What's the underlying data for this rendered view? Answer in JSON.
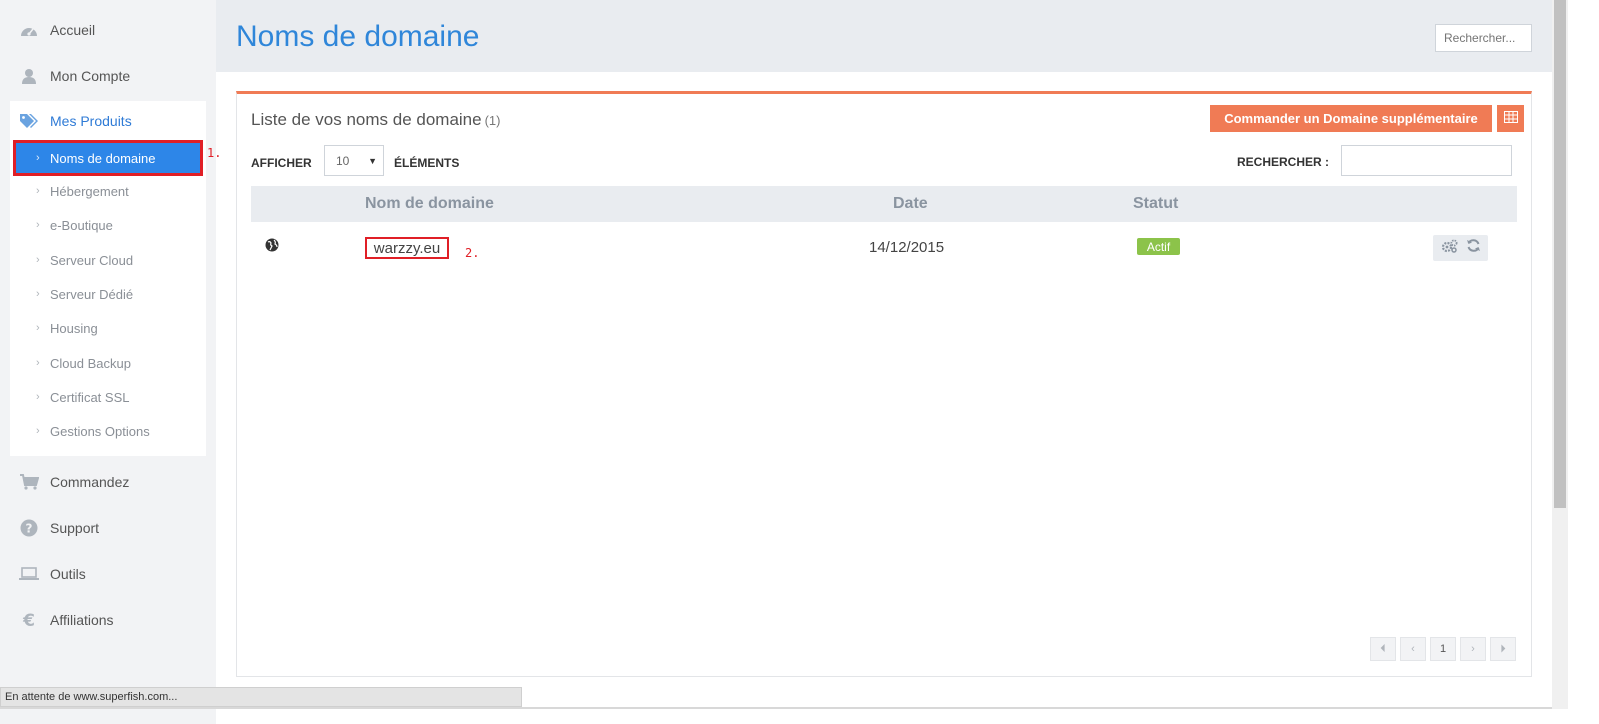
{
  "sidebar": {
    "top_items": [
      {
        "label": "Accueil",
        "icon": "dashboard-icon"
      },
      {
        "label": "Mon Compte",
        "icon": "user-icon"
      }
    ],
    "products": {
      "label": "Mes Produits",
      "icon": "tags-icon",
      "items": [
        {
          "label": "Noms de domaine",
          "active": true
        },
        {
          "label": "Hébergement"
        },
        {
          "label": "e-Boutique"
        },
        {
          "label": "Serveur Cloud"
        },
        {
          "label": "Serveur Dédié"
        },
        {
          "label": "Housing"
        },
        {
          "label": "Cloud Backup"
        },
        {
          "label": "Certificat SSL"
        },
        {
          "label": "Gestions Options"
        }
      ]
    },
    "bottom_items": [
      {
        "label": "Commandez",
        "icon": "cart-icon"
      },
      {
        "label": "Support",
        "icon": "question-icon"
      },
      {
        "label": "Outils",
        "icon": "laptop-icon"
      },
      {
        "label": "Affiliations",
        "icon": "euro-icon"
      }
    ]
  },
  "annotations": {
    "step1": "1.",
    "step2": "2."
  },
  "header": {
    "title": "Noms de domaine",
    "search_placeholder": "Rechercher..."
  },
  "panel": {
    "title": "Liste de vos noms de domaine",
    "count": "(1)",
    "order_button": "Commander un Domaine supplémentaire",
    "show_label": "AFFICHER",
    "page_size": "10",
    "elements_label": "ÉLÉMENTS",
    "search_label": "RECHERCHER :",
    "columns": [
      "Nom de domaine",
      "Date",
      "Statut"
    ],
    "rows": [
      {
        "domain": "warzzy.eu",
        "date": "14/12/2015",
        "status": "Actif"
      }
    ],
    "pagination": {
      "current": "1"
    }
  },
  "status_bar": "En attente de www.superfish.com...",
  "colors": {
    "accent_blue": "#2d86e8",
    "accent_orange": "#f07b55",
    "status_green": "#8cc34a",
    "highlight_red": "#e01f26"
  }
}
